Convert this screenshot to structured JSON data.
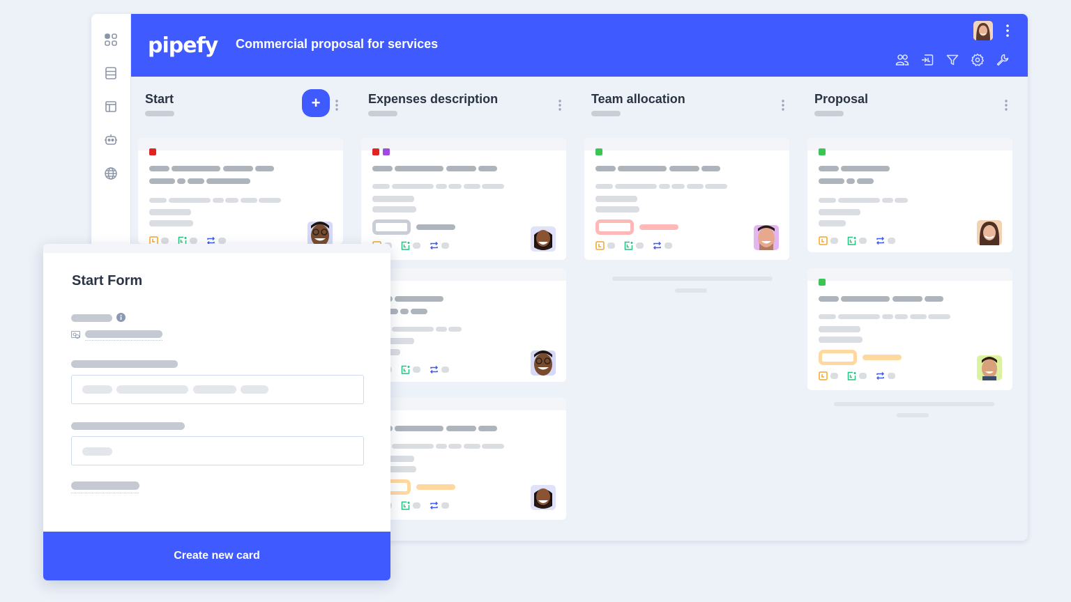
{
  "app": {
    "logo": "pipefy",
    "pipe_title": "Commercial proposal for services",
    "accent_color": "#3f5afe"
  },
  "sidebar": {
    "items": [
      {
        "icon": "grid-icon"
      },
      {
        "icon": "database-icon"
      },
      {
        "icon": "layout-icon"
      },
      {
        "icon": "robot-icon"
      },
      {
        "icon": "globe-icon"
      }
    ]
  },
  "header_tools": [
    "members-icon",
    "import-icon",
    "filter-icon",
    "settings-icon",
    "wrench-icon"
  ],
  "phases": [
    {
      "title": "Start",
      "has_add_button": true,
      "add_label": "+"
    },
    {
      "title": "Expenses description"
    },
    {
      "title": "Team allocation"
    },
    {
      "title": "Proposal"
    }
  ],
  "label_colors": {
    "red": "#e02424",
    "purple": "#9f4ae0",
    "green": "#3cc456"
  },
  "form": {
    "title": "Start Form",
    "submit_label": "Create new card"
  }
}
